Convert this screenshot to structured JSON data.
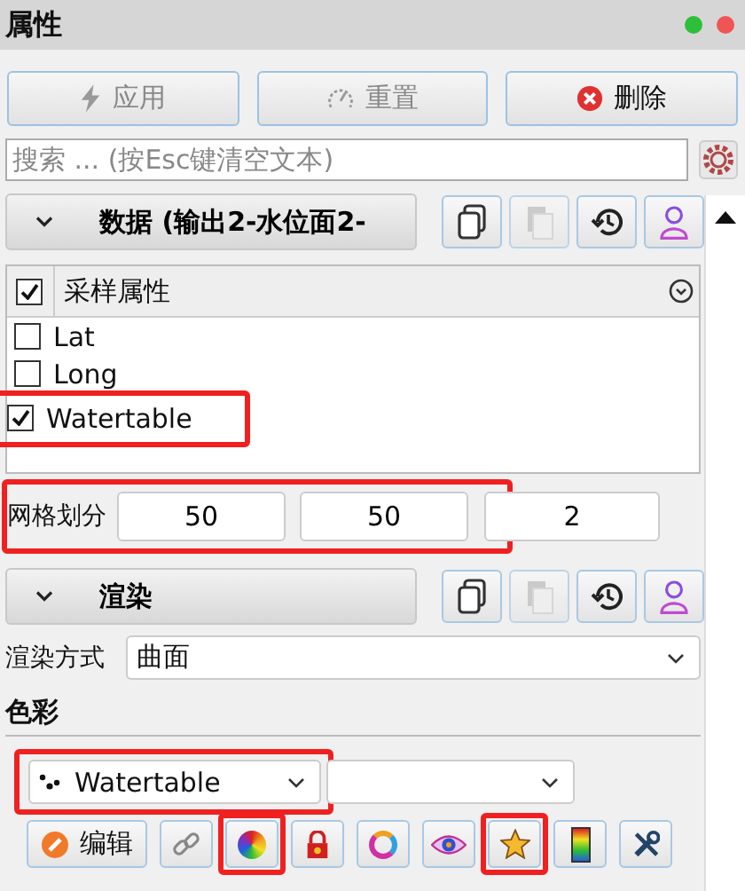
{
  "panel": {
    "title": "属性"
  },
  "window_controls": [
    {
      "color": "#2ebf3a"
    },
    {
      "color": "#f05454"
    }
  ],
  "actions": [
    {
      "label": "应用",
      "kind": "apply",
      "disabled": true
    },
    {
      "label": "重置",
      "kind": "reset",
      "disabled": true
    },
    {
      "label": "删除",
      "kind": "delete",
      "disabled": false
    }
  ],
  "search": {
    "placeholder": "搜索 ... (按Esc键清空文本)"
  },
  "data_section": {
    "title": "数据 (输出2-水位面2-",
    "expanded": true,
    "tools": [
      {
        "kind": "copy",
        "disabled": false
      },
      {
        "kind": "paste",
        "disabled": true
      },
      {
        "kind": "history",
        "disabled": false
      },
      {
        "kind": "person",
        "disabled": false
      }
    ]
  },
  "attributes": {
    "header": "采样属性",
    "checked": true,
    "items": [
      {
        "label": "Lat",
        "checked": false,
        "highlighted": false
      },
      {
        "label": "Long",
        "checked": false,
        "highlighted": false
      },
      {
        "label": "Watertable",
        "checked": true,
        "highlighted": true
      }
    ]
  },
  "grid": {
    "label": "网格划分",
    "values": [
      "50",
      "50",
      "2"
    ],
    "highlighted": true
  },
  "render_section": {
    "title": "渲染",
    "expanded": true,
    "tools": [
      {
        "kind": "copy",
        "disabled": false
      },
      {
        "kind": "paste",
        "disabled": true
      },
      {
        "kind": "history",
        "disabled": false
      },
      {
        "kind": "person",
        "disabled": false
      }
    ]
  },
  "render_mode": {
    "label": "渲染方式",
    "value": "曲面"
  },
  "color": {
    "heading": "色彩",
    "scalar": {
      "value": "Watertable",
      "highlighted": true
    },
    "tools": [
      {
        "kind": "edit",
        "label": "编辑",
        "highlighted": false
      },
      {
        "kind": "link",
        "highlighted": false
      },
      {
        "kind": "wheel",
        "highlighted": true
      },
      {
        "kind": "lock",
        "highlighted": false
      },
      {
        "kind": "ring",
        "highlighted": false
      },
      {
        "kind": "eye",
        "highlighted": false
      },
      {
        "kind": "star",
        "highlighted": true
      },
      {
        "kind": "gradient",
        "highlighted": false
      },
      {
        "kind": "wrench",
        "highlighted": false
      }
    ]
  }
}
